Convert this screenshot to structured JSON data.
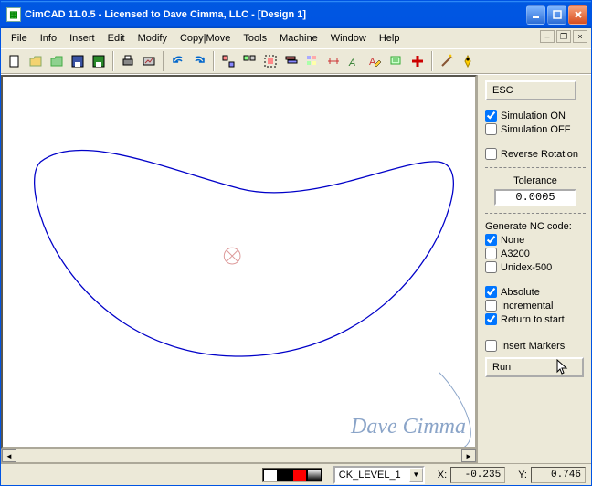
{
  "window": {
    "title": "CimCAD 11.0.5 - Licensed to Dave Cimma, LLC - [Design 1]"
  },
  "menu": {
    "items": [
      "File",
      "Info",
      "Insert",
      "Edit",
      "Modify",
      "Copy|Move",
      "Tools",
      "Machine",
      "Window",
      "Help"
    ]
  },
  "panel": {
    "esc_label": "ESC",
    "simulation_on": "Simulation ON",
    "simulation_off": "Simulation OFF",
    "reverse_rotation": "Reverse Rotation",
    "tolerance_label": "Tolerance",
    "tolerance_value": "0.0005",
    "generate_label": "Generate NC code:",
    "none": "None",
    "a3200": "A3200",
    "unidex": "Unidex-500",
    "absolute": "Absolute",
    "incremental": "Incremental",
    "return_to_start": "Return to start",
    "insert_markers": "Insert Markers",
    "run_label": "Run",
    "checks": {
      "simulation_on": true,
      "simulation_off": false,
      "reverse_rotation": false,
      "none": true,
      "a3200": false,
      "unidex": false,
      "absolute": true,
      "incremental": false,
      "return_to_start": true,
      "insert_markers": false
    }
  },
  "status": {
    "layer_value": "CK_LEVEL_1",
    "x_label": "X:",
    "x_value": "-0.235",
    "y_label": "Y:",
    "y_value": "0.746"
  },
  "watermark": "Dave  Cimma",
  "colors": {
    "accent_blue": "#0054e3",
    "shape_blue": "#0000c8",
    "origin_red": "#d99"
  }
}
